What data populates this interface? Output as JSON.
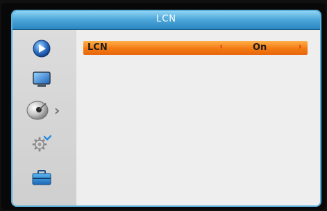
{
  "menu": {
    "title": "LCN"
  },
  "sidebar": {
    "items": [
      {
        "icon": "play-icon",
        "selected": false
      },
      {
        "icon": "tv-icon",
        "selected": false
      },
      {
        "icon": "satellite-dish-icon",
        "selected": true,
        "indicator": "›"
      },
      {
        "icon": "settings-gear-icon",
        "selected": false
      },
      {
        "icon": "toolbox-icon",
        "selected": false
      }
    ]
  },
  "settings": [
    {
      "label": "LCN",
      "value": "On",
      "left_arrow": "‹",
      "right_arrow": "›"
    }
  ],
  "colors": {
    "title_bar": "#4fa8da",
    "frame": "#1c6fa6",
    "highlight": "#f27a12",
    "arrow": "#d4281a"
  }
}
